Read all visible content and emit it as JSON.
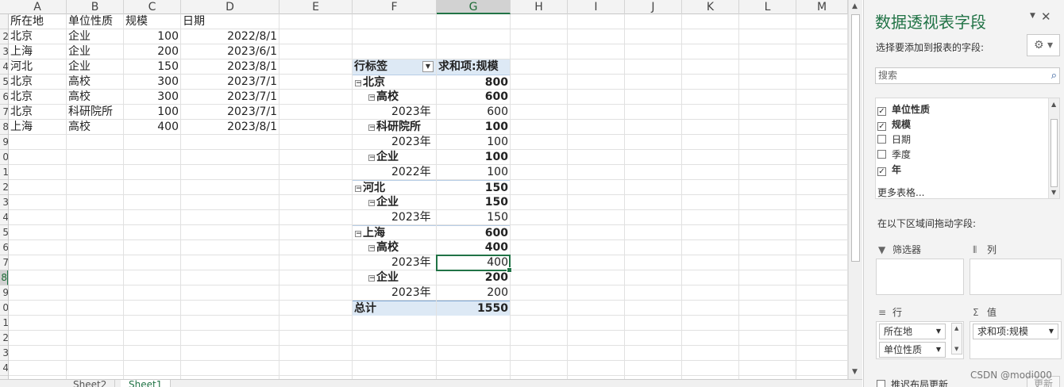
{
  "columns": [
    "A",
    "B",
    "C",
    "D",
    "E",
    "F",
    "G",
    "H",
    "I",
    "J",
    "K",
    "L",
    "M"
  ],
  "active_column": "G",
  "row_numbers": [
    "",
    "2",
    "3",
    "4",
    "5",
    "6",
    "7",
    "8",
    "9",
    "0",
    "1",
    "2",
    "3",
    "4",
    "5",
    "6",
    "7",
    "8",
    "9",
    "0",
    "1",
    "2",
    "3",
    "4",
    "5"
  ],
  "active_row_index": 17,
  "source": {
    "headers": [
      "所在地",
      "单位性质",
      "规模",
      "日期"
    ],
    "rows": [
      [
        "北京",
        "企业",
        "100",
        "2022/8/1"
      ],
      [
        "上海",
        "企业",
        "200",
        "2023/6/1"
      ],
      [
        "河北",
        "企业",
        "150",
        "2023/8/1"
      ],
      [
        "北京",
        "高校",
        "300",
        "2023/7/1"
      ],
      [
        "北京",
        "高校",
        "300",
        "2023/7/1"
      ],
      [
        "北京",
        "科研院所",
        "100",
        "2023/7/1"
      ],
      [
        "上海",
        "高校",
        "400",
        "2023/8/1"
      ]
    ]
  },
  "pivot": {
    "row_label_header": "行标签",
    "value_header": "求和项:规模",
    "rows": [
      {
        "level": 0,
        "label": "北京",
        "value": "800",
        "toggle": "⊟"
      },
      {
        "level": 1,
        "label": "高校",
        "value": "600",
        "toggle": "⊟"
      },
      {
        "level": 2,
        "label": "2023年",
        "value": "600",
        "toggle": ""
      },
      {
        "level": 1,
        "label": "科研院所",
        "value": "100",
        "toggle": "⊟"
      },
      {
        "level": 2,
        "label": "2023年",
        "value": "100",
        "toggle": ""
      },
      {
        "level": 1,
        "label": "企业",
        "value": "100",
        "toggle": "⊟"
      },
      {
        "level": 2,
        "label": "2022年",
        "value": "100",
        "toggle": ""
      },
      {
        "level": 0,
        "label": "河北",
        "value": "150",
        "toggle": "⊟"
      },
      {
        "level": 1,
        "label": "企业",
        "value": "150",
        "toggle": "⊟"
      },
      {
        "level": 2,
        "label": "2023年",
        "value": "150",
        "toggle": ""
      },
      {
        "level": 0,
        "label": "上海",
        "value": "600",
        "toggle": "⊟"
      },
      {
        "level": 1,
        "label": "高校",
        "value": "400",
        "toggle": "⊟"
      },
      {
        "level": 2,
        "label": "2023年",
        "value": "400",
        "toggle": ""
      },
      {
        "level": 1,
        "label": "企业",
        "value": "200",
        "toggle": "⊟"
      },
      {
        "level": 2,
        "label": "2023年",
        "value": "200",
        "toggle": ""
      }
    ],
    "total_label": "总计",
    "total_value": "1550"
  },
  "sheet_tabs": [
    {
      "label": "Sheet2",
      "active": false
    },
    {
      "label": "Sheet1",
      "active": true
    }
  ],
  "pane": {
    "title": "数据透视表字段",
    "close": "✕",
    "choose_label": "选择要添加到报表的字段:",
    "gear_icon": "gear-icon",
    "search_placeholder": "搜索",
    "fields": [
      {
        "label": "单位性质",
        "checked": true
      },
      {
        "label": "规模",
        "checked": true
      },
      {
        "label": "日期",
        "checked": false
      },
      {
        "label": "季度",
        "checked": false
      },
      {
        "label": "年",
        "checked": true
      }
    ],
    "more_tables": "更多表格...",
    "drag_hint": "在以下区域间拖动字段:",
    "filters_label": "筛选器",
    "columns_label": "列",
    "rows_label": "行",
    "values_label": "值",
    "row_fields": [
      "所在地",
      "单位性质"
    ],
    "value_fields": [
      "求和项:规模"
    ],
    "defer_label": "推迟布局更新",
    "update_label": "更新"
  },
  "watermark": "CSDN @modi000",
  "accent_color": "#217346"
}
